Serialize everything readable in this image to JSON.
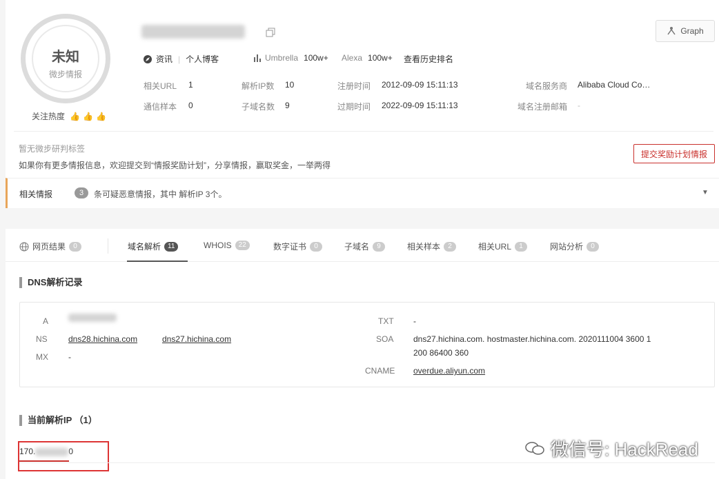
{
  "score": {
    "main": "未知",
    "sub": "微步情报"
  },
  "heat": {
    "label": "关注热度",
    "thumbs": "👍👍👍"
  },
  "graph_button": {
    "label": "Graph"
  },
  "meta": {
    "category_label": "资讯",
    "category_value": "个人博客",
    "umbrella_label": "Umbrella",
    "umbrella_value": "100w+",
    "alexa_label": "Alexa",
    "alexa_value": "100w+",
    "history_link": "查看历史排名"
  },
  "info": {
    "related_url_label": "相关URL",
    "related_url_value": "1",
    "resolved_ip_label": "解析IP数",
    "resolved_ip_value": "10",
    "reg_time_label": "注册时间",
    "reg_time_value": "2012-09-09 15:11:13",
    "registrar_label": "域名服务商",
    "registrar_value": "Alibaba Cloud Co…",
    "samples_label": "通信样本",
    "samples_value": "0",
    "subdomain_label": "子域名数",
    "subdomain_value": "9",
    "exp_time_label": "过期时间",
    "exp_time_value": "2022-09-09 15:11:13",
    "email_label": "域名注册邮箱",
    "email_value": "-"
  },
  "tags": {
    "none_note": "暂无微步研判标签",
    "desc": "如果你有更多情报信息，欢迎提交到“情报奖励计划”，分享情报，赢取奖金，一举两得",
    "submit_label": "提交奖励计划情报"
  },
  "related": {
    "title": "相关情报",
    "count": "3",
    "desc": "条可疑恶意情报，其中 解析IP 3个。"
  },
  "tabs": [
    {
      "label": "网页结果",
      "count": "0"
    },
    {
      "label": "域名解析",
      "count": "11"
    },
    {
      "label": "WHOIS",
      "count": "22"
    },
    {
      "label": "数字证书",
      "count": "0"
    },
    {
      "label": "子域名",
      "count": "9"
    },
    {
      "label": "相关样本",
      "count": "2"
    },
    {
      "label": "相关URL",
      "count": "1"
    },
    {
      "label": "网站分析",
      "count": "0"
    }
  ],
  "dns": {
    "title": "DNS解析记录",
    "a_label": "A",
    "ns_label": "NS",
    "ns_values": [
      "dns28.hichina.com",
      "dns27.hichina.com"
    ],
    "mx_label": "MX",
    "mx_value": "-",
    "txt_label": "TXT",
    "txt_value": "-",
    "soa_label": "SOA",
    "soa_value_line1": "dns27.hichina.com. hostmaster.hichina.com. 2020111004 3600 1",
    "soa_value_line2": "200 86400 360",
    "cname_label": "CNAME",
    "cname_value": "overdue.aliyun.com"
  },
  "current_ip": {
    "title": "当前解析IP （1）",
    "ip_prefix": "170.",
    "ip_suffix": "0"
  },
  "watermark": {
    "text": "微信号: HackRead"
  }
}
